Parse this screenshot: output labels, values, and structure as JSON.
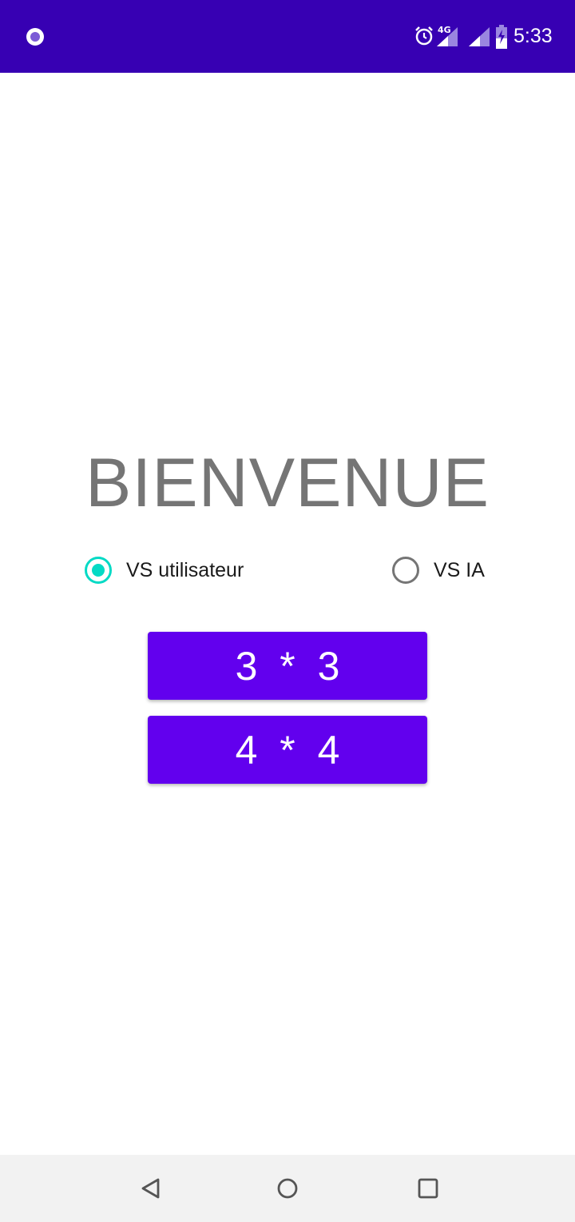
{
  "status_bar": {
    "time": "5:33",
    "network_label": "4G",
    "background_color": "#3700b3",
    "icons": [
      "notification-dot-icon",
      "alarm-icon",
      "signal-icon",
      "signal-icon",
      "battery-icon"
    ]
  },
  "main": {
    "title": "BIENVENUE",
    "mode_options": [
      {
        "label": "VS utilisateur",
        "checked": true
      },
      {
        "label": "VS IA",
        "checked": false
      }
    ],
    "grid_buttons": [
      {
        "label": "3 * 3"
      },
      {
        "label": "4 * 4"
      }
    ],
    "accent_color": "#6200ee",
    "radio_checked_color": "#03dac5"
  },
  "nav_bar": {
    "icons": [
      "back-icon",
      "home-icon",
      "recent-apps-icon"
    ]
  }
}
